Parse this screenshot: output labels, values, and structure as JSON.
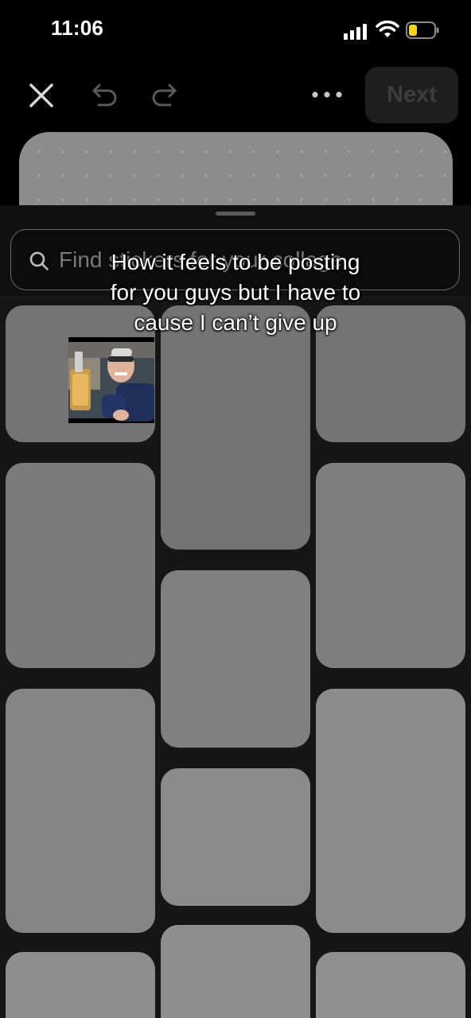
{
  "status_bar": {
    "time": "11:06",
    "icons": [
      "signal-icon",
      "wifi-icon",
      "battery-icon"
    ],
    "battery_color": "#f7d417"
  },
  "toolbar": {
    "icons": [
      "close-icon",
      "undo-icon",
      "redo-icon",
      "more-icon"
    ],
    "next_label": "Next"
  },
  "search": {
    "icon": "search-icon",
    "placeholder": "Find stickers for your collage",
    "value": ""
  },
  "caption": {
    "lines": [
      "How it feels to be posting",
      "for you guys but I have to",
      "cause I can’t give up"
    ]
  },
  "video_thumbnail": {
    "description_icon": "person-video-icon"
  }
}
